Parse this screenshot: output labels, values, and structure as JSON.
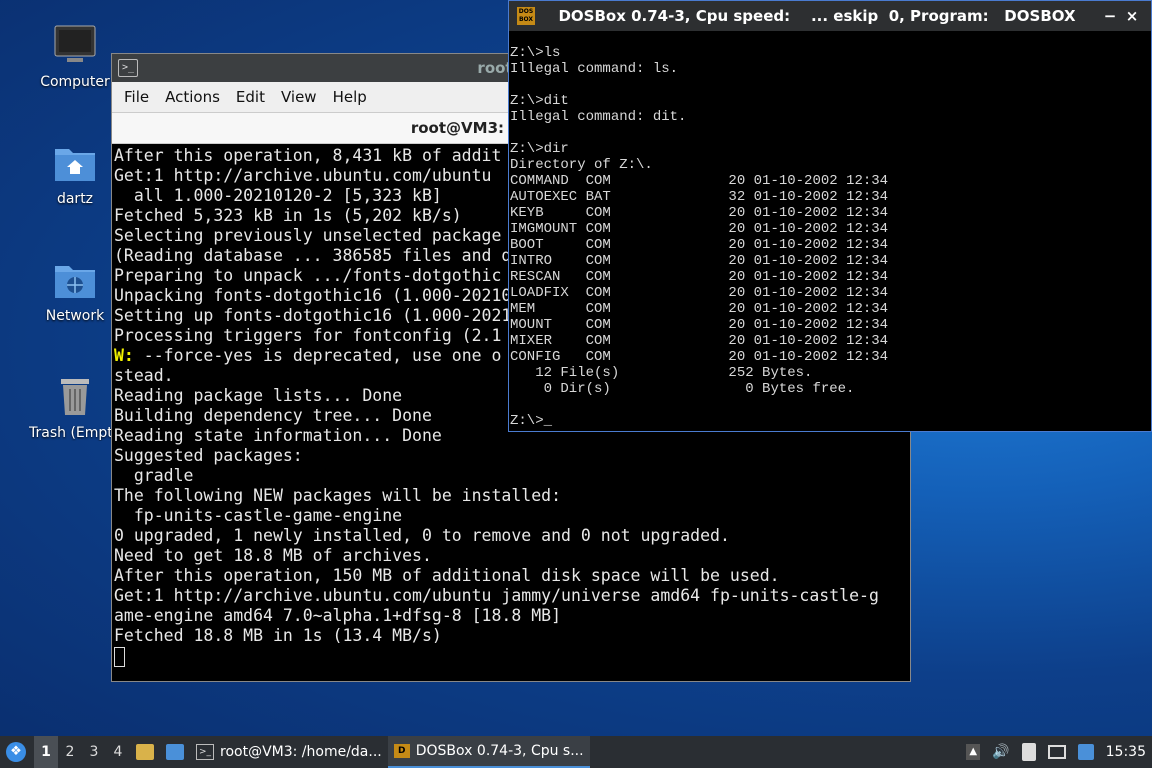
{
  "desktop": {
    "icons": [
      {
        "label": "Computer"
      },
      {
        "label": "dartz"
      },
      {
        "label": "Network"
      },
      {
        "label": "Trash (Empt"
      }
    ]
  },
  "terminal": {
    "window_title": "root@VM3:",
    "menu": [
      "File",
      "Actions",
      "Edit",
      "View",
      "Help"
    ],
    "tab_title": "root@VM3: /home/dartz",
    "lines_top": [
      "After this operation, 8,431 kB of addit",
      "Get:1 http://archive.ubuntu.com/ubuntu",
      "  all 1.000-20210120-2 [5,323 kB]",
      "Fetched 5,323 kB in 1s (5,202 kB/s)",
      "Selecting previously unselected package",
      "(Reading database ... 386585 files and d",
      "Preparing to unpack .../fonts-dotgothic",
      "Unpacking fonts-dotgothic16 (1.000-20210",
      "Setting up fonts-dotgothic16 (1.000-2021",
      "Processing triggers for fontconfig (2.1"
    ],
    "warn_prefix": "W:",
    "warn_text": " --force-yes is deprecated, use one o",
    "lines_bottom": [
      "stead.",
      "Reading package lists... Done",
      "Building dependency tree... Done",
      "Reading state information... Done",
      "Suggested packages:",
      "  gradle",
      "The following NEW packages will be installed:",
      "  fp-units-castle-game-engine",
      "0 upgraded, 1 newly installed, 0 to remove and 0 not upgraded.",
      "Need to get 18.8 MB of archives.",
      "After this operation, 150 MB of additional disk space will be used.",
      "Get:1 http://archive.ubuntu.com/ubuntu jammy/universe amd64 fp-units-castle-g",
      "ame-engine amd64 7.0~alpha.1+dfsg-8 [18.8 MB]",
      "Fetched 18.8 MB in 1s (13.4 MB/s)"
    ]
  },
  "dosbox": {
    "icon_text": "DOS BOX",
    "title": "DOSBox 0.74-3, Cpu speed:    ... eskip  0, Program:   DOSBOX",
    "minimize": "−",
    "close": "×",
    "lines": [
      "Z:\\>ls",
      "Illegal command: ls.",
      "",
      "Z:\\>dit",
      "Illegal command: dit.",
      "",
      "Z:\\>dir",
      "Directory of Z:\\.",
      "COMMAND  COM              20 01-10-2002 12:34",
      "AUTOEXEC BAT              32 01-10-2002 12:34",
      "KEYB     COM              20 01-10-2002 12:34",
      "IMGMOUNT COM              20 01-10-2002 12:34",
      "BOOT     COM              20 01-10-2002 12:34",
      "INTRO    COM              20 01-10-2002 12:34",
      "RESCAN   COM              20 01-10-2002 12:34",
      "LOADFIX  COM              20 01-10-2002 12:34",
      "MEM      COM              20 01-10-2002 12:34",
      "MOUNT    COM              20 01-10-2002 12:34",
      "MIXER    COM              20 01-10-2002 12:34",
      "CONFIG   COM              20 01-10-2002 12:34",
      "   12 File(s)             252 Bytes.",
      "    0 Dir(s)                0 Bytes free.",
      "",
      "Z:\\>_"
    ]
  },
  "taskbar": {
    "workspaces": [
      "1",
      "2",
      "3",
      "4"
    ],
    "tasks": [
      {
        "label": "root@VM3: /home/da..."
      },
      {
        "label": "DOSBox 0.74-3, Cpu s..."
      }
    ],
    "clock": "15:35"
  }
}
